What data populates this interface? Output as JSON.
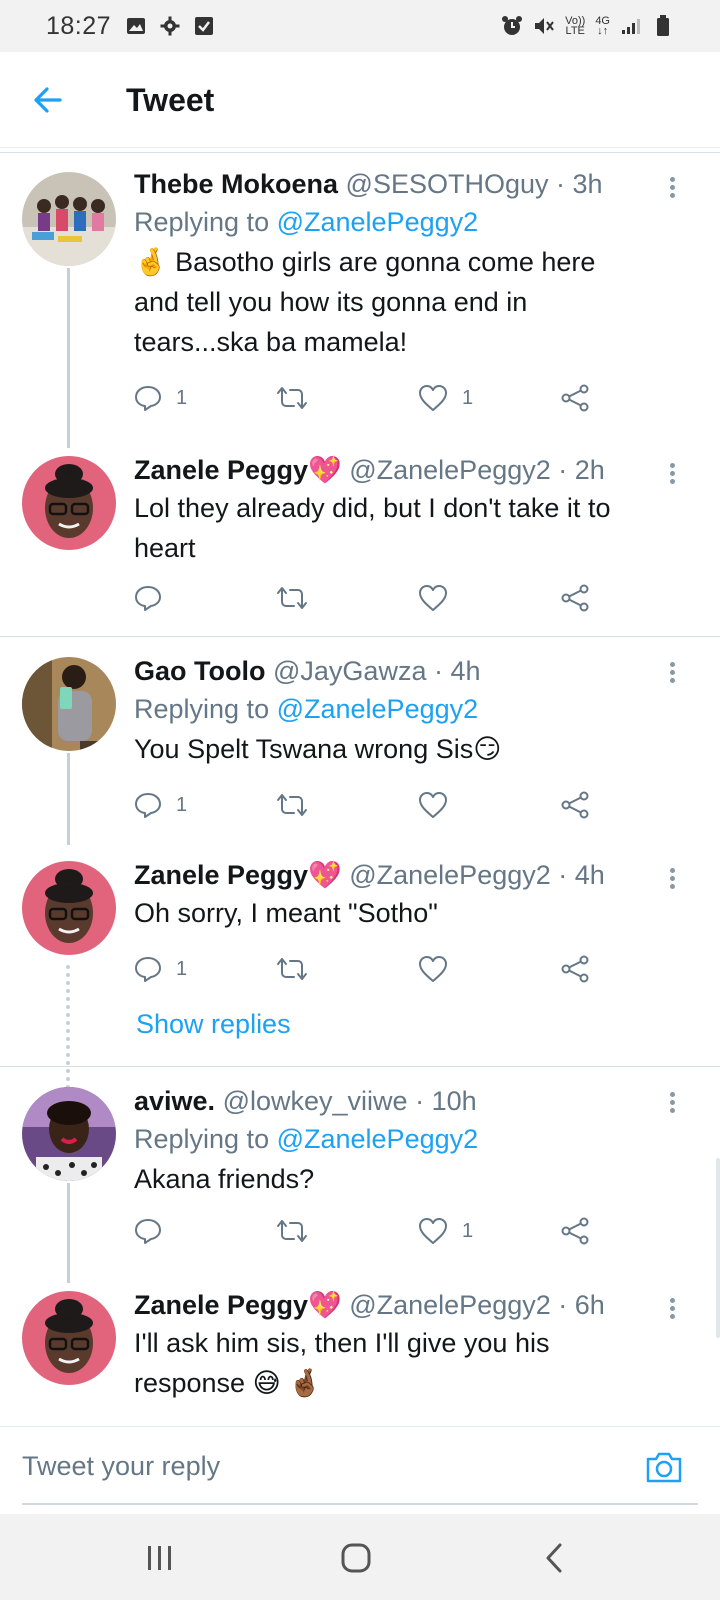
{
  "status_bar": {
    "time": "18:27",
    "left_icons": [
      "image-icon",
      "gear-icon",
      "checkbox-icon"
    ],
    "right_icons": [
      "alarm-icon",
      "mute-icon",
      "volte-icon",
      "4g-icon",
      "signal-icon",
      "battery-icon"
    ],
    "volte_top": "Vo))",
    "volte_bottom": "LTE",
    "net_top": "4G",
    "net_bottom": "↓↑"
  },
  "app_bar": {
    "title": "Tweet",
    "back_icon": "arrow-left-icon"
  },
  "tweets": [
    {
      "name": "Thebe Mokoena",
      "heart": "",
      "handle": "@SESOTHOguy",
      "time": "3h",
      "replying_prefix": "Replying to ",
      "replying_to": "@ZanelePeggy2",
      "text_lines": [
        "🤞 Basotho girls are gonna come here",
        "and tell you how its gonna end in",
        "tears...ska ba mamela!"
      ],
      "reply_count": "1",
      "retweet_count": "",
      "like_count": "1"
    },
    {
      "name": "Zanele Peggy",
      "heart": "💖",
      "handle": "@ZanelePeggy2",
      "time": "2h",
      "replying_prefix": "",
      "replying_to": "",
      "text_lines": [
        "Lol they already did, but I don't take it to",
        "heart"
      ],
      "reply_count": "",
      "retweet_count": "",
      "like_count": ""
    },
    {
      "name": "Gao Toolo",
      "heart": "",
      "handle": "@JayGawza",
      "time": "4h",
      "replying_prefix": "Replying to ",
      "replying_to": "@ZanelePeggy2",
      "text_lines": [
        "You Spelt Tswana wrong Sis😏"
      ],
      "reply_count": "1",
      "retweet_count": "",
      "like_count": ""
    },
    {
      "name": "Zanele Peggy",
      "heart": "💖",
      "handle": "@ZanelePeggy2",
      "time": "4h",
      "replying_prefix": "",
      "replying_to": "",
      "text_lines": [
        "Oh sorry, I meant \"Sotho\""
      ],
      "reply_count": "1",
      "retweet_count": "",
      "like_count": ""
    },
    {
      "name": "aviwe.",
      "heart": "",
      "handle": "@lowkey_viiwe",
      "time": "10h",
      "replying_prefix": "Replying to ",
      "replying_to": "@ZanelePeggy2",
      "text_lines": [
        "Akana friends?"
      ],
      "reply_count": "",
      "retweet_count": "",
      "like_count": "1"
    },
    {
      "name": "Zanele Peggy",
      "heart": "💖",
      "handle": "@ZanelePeggy2",
      "time": "6h",
      "replying_prefix": "",
      "replying_to": "",
      "text_lines": [
        "I'll ask him sis, then I'll give you his",
        "response 😅 🤞🏾"
      ],
      "reply_count": "",
      "retweet_count": "",
      "like_count": ""
    }
  ],
  "show_replies": "Show replies",
  "reply_bar": {
    "placeholder": "Tweet your reply",
    "camera_icon": "camera-icon"
  },
  "nav_bar": {
    "icons": [
      "recent-apps-icon",
      "home-icon",
      "back-icon"
    ]
  },
  "colors": {
    "accent": "#1da1f2",
    "text": "#14171a",
    "secondary": "#657786",
    "heart": "#e0245e"
  }
}
